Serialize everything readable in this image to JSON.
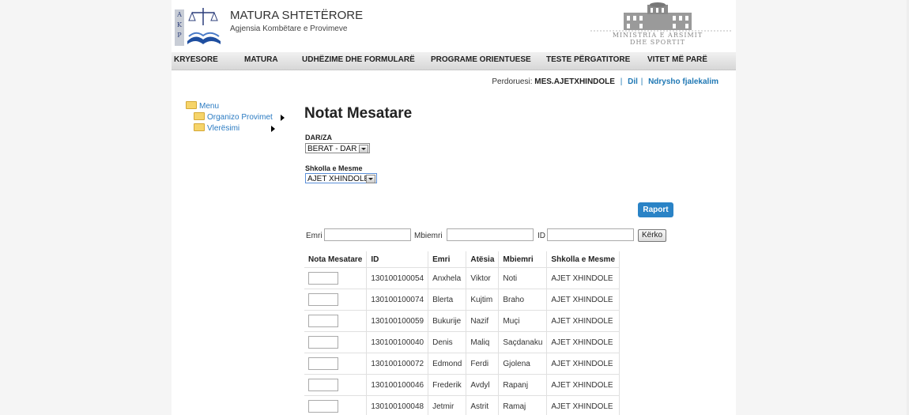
{
  "header": {
    "logo_letters": [
      "A",
      "K",
      "P"
    ],
    "site_title": "MATURA SHTETËRORE",
    "site_subtitle": "Agjensia Kombëtare e Provimeve",
    "ministry_line1": "MINISTRIA E ARSIMIT",
    "ministry_line2": "DHE SPORTIT"
  },
  "nav": {
    "items": [
      {
        "label": "KRYESORE"
      },
      {
        "label": "MATURA"
      },
      {
        "label": "UDHËZIME DHE FORMULARË"
      },
      {
        "label": "PROGRAME ORIENTUESE"
      },
      {
        "label": "TESTE PËRGATITORE"
      },
      {
        "label": "VITET MË PARË"
      }
    ]
  },
  "userbar": {
    "user_label": "Perdoruesi:",
    "user_name": "MES.AJETXHINDOLE",
    "separator": "|",
    "logout": "Dil",
    "change_password": "Ndrysho fjalekalim"
  },
  "menu": {
    "root": "Menu",
    "items": [
      {
        "label": "Organizo Provimet"
      },
      {
        "label": "Vlerësimi"
      }
    ]
  },
  "main": {
    "title": "Notat Mesatare",
    "darza_label": "DAR/ZA",
    "darza_value": "BERAT - DAR",
    "school_label": "Shkolla e Mesme",
    "school_value": "AJET XHINDOLE",
    "raport_button": "Raport",
    "search": {
      "first_name_label": "Emri",
      "last_name_label": "Mbiemri",
      "id_label": "ID",
      "search_button": "Kërko"
    }
  },
  "table": {
    "headers": [
      "Nota Mesatare",
      "ID",
      "Emri",
      "Atësia",
      "Mbiemri",
      "Shkolla e Mesme"
    ],
    "rows": [
      {
        "id": "130100100054",
        "first": "Anxhela",
        "father": "Viktor",
        "last": "Noti",
        "school": "AJET XHINDOLE"
      },
      {
        "id": "130100100074",
        "first": "Blerta",
        "father": "Kujtim",
        "last": "Braho",
        "school": "AJET XHINDOLE"
      },
      {
        "id": "130100100059",
        "first": "Bukurije",
        "father": "Nazif",
        "last": "Muçi",
        "school": "AJET XHINDOLE"
      },
      {
        "id": "130100100040",
        "first": "Denis",
        "father": "Maliq",
        "last": "Saçdanaku",
        "school": "AJET XHINDOLE"
      },
      {
        "id": "130100100072",
        "first": "Edmond",
        "father": "Ferdi",
        "last": "Gjolena",
        "school": "AJET XHINDOLE"
      },
      {
        "id": "130100100046",
        "first": "Frederik",
        "father": "Avdyl",
        "last": "Rapanj",
        "school": "AJET XHINDOLE"
      },
      {
        "id": "130100100048",
        "first": "Jetmir",
        "father": "Astrit",
        "last": "Ramaj",
        "school": "AJET XHINDOLE"
      }
    ]
  },
  "colors": {
    "accent": "#2a83c6",
    "link": "#1f78b4",
    "folder": "#f6d46a"
  }
}
